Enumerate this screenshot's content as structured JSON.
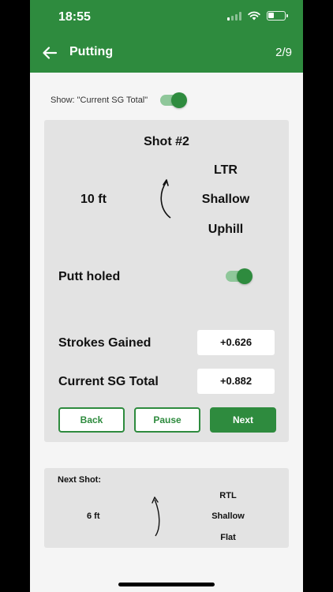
{
  "status_bar": {
    "time": "18:55"
  },
  "header": {
    "title": "Putting",
    "page_counter": "2/9"
  },
  "show_toggle": {
    "label": "Show: \"Current SG Total\"",
    "on": true
  },
  "shot": {
    "title": "Shot #2",
    "distance": "10 ft",
    "break": "LTR",
    "slope": "Shallow",
    "direction": "Uphill",
    "holed_label": "Putt holed",
    "holed_on": true
  },
  "metrics": {
    "strokes_gained_label": "Strokes Gained",
    "strokes_gained_value": "+0.626",
    "sg_total_label": "Current SG Total",
    "sg_total_value": "+0.882"
  },
  "buttons": {
    "back": "Back",
    "pause": "Pause",
    "next": "Next"
  },
  "next_shot": {
    "title": "Next Shot:",
    "distance": "6 ft",
    "break": "RTL",
    "slope": "Shallow",
    "direction": "Flat"
  },
  "colors": {
    "brand_green": "#2e8b3e",
    "card_bg": "#e3e3e3",
    "toggle_track": "#8fc79a"
  }
}
